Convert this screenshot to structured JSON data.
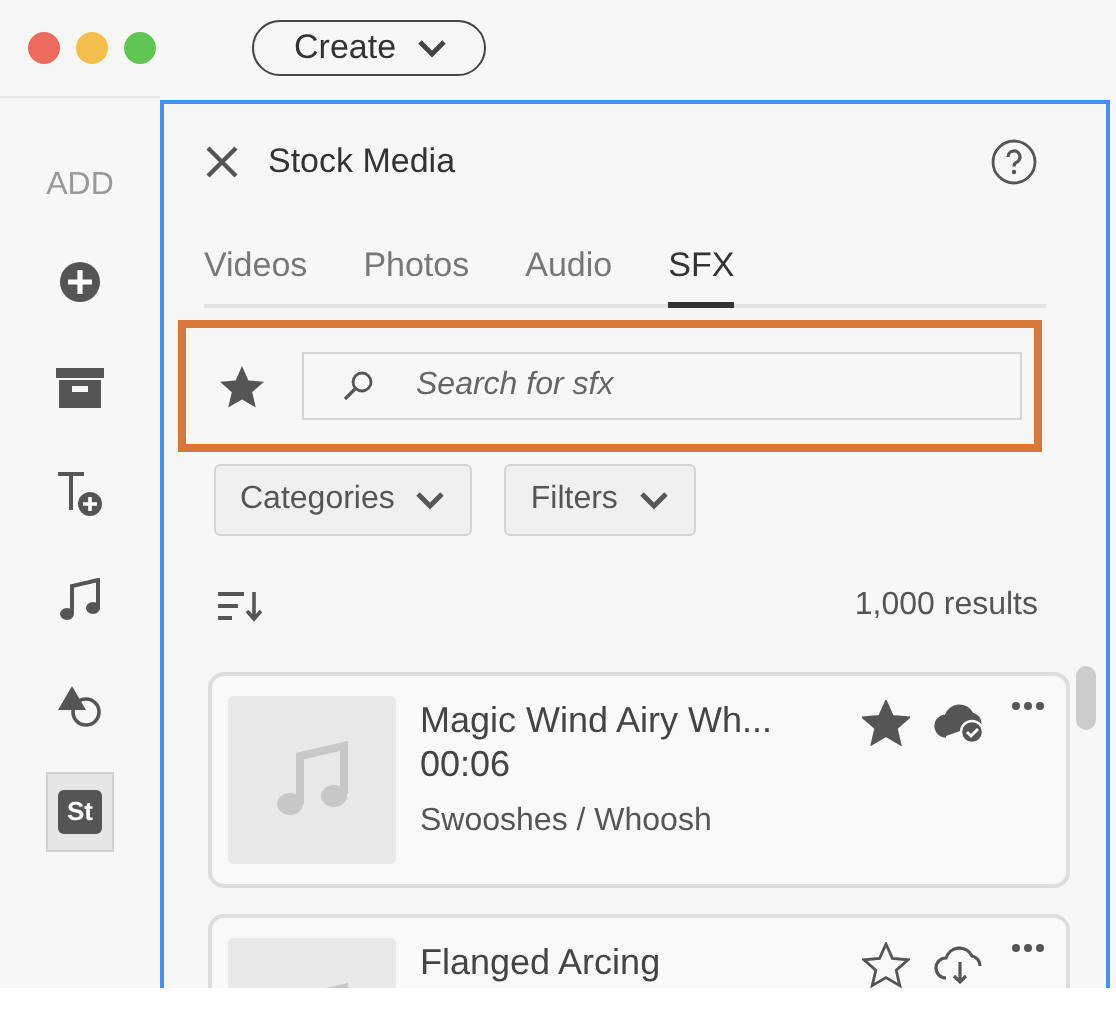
{
  "toolbar": {
    "create_button": "Create"
  },
  "sidebar": {
    "heading": "ADD",
    "items": [
      {
        "kind": "add",
        "selected": false
      },
      {
        "kind": "archive",
        "selected": false
      },
      {
        "kind": "text",
        "selected": false
      },
      {
        "kind": "music",
        "selected": false
      },
      {
        "kind": "shapes",
        "selected": false
      },
      {
        "kind": "stock",
        "label": "St",
        "selected": true
      }
    ]
  },
  "panel": {
    "title": "Stock Media",
    "tabs": [
      {
        "label": "Videos",
        "selected": false
      },
      {
        "label": "Photos",
        "selected": false
      },
      {
        "label": "Audio",
        "selected": false
      },
      {
        "label": "SFX",
        "selected": true
      }
    ],
    "search": {
      "placeholder": "Search for sfx"
    },
    "dropdowns": [
      "Categories",
      "Filters"
    ],
    "results_count": "1,000 results",
    "items": [
      {
        "title": "Magic Wind Airy Wh...",
        "duration": "00:06",
        "category": "Swooshes / Whoosh",
        "favorited": true,
        "downloaded": true
      },
      {
        "title": "Flanged Arcing",
        "favorited": false,
        "downloaded": false
      }
    ]
  }
}
